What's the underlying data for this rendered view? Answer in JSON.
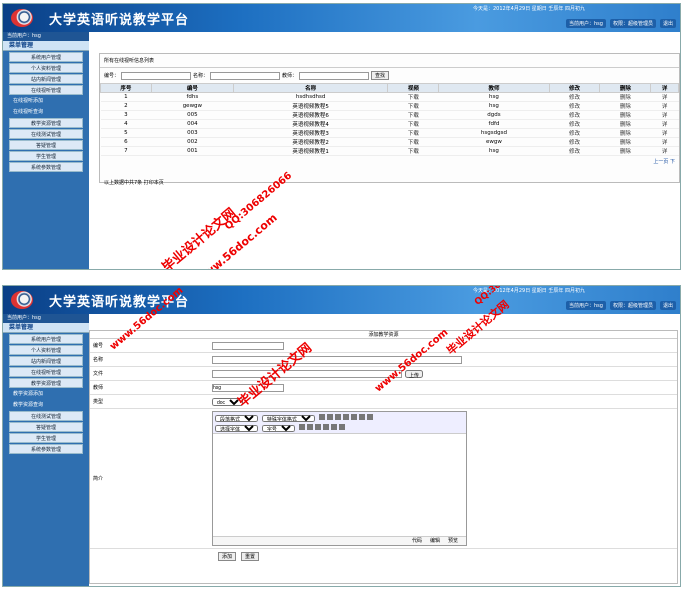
{
  "app_title": "大学英语听说教学平台",
  "date_line": "今天是：2012年4月29日 星期日 壬辰年 四月初九",
  "user_links": [
    "当前用户：hsg",
    "权限：超级管理员",
    "退出"
  ],
  "sidebar": {
    "top": "当前用户：hsg",
    "head": "菜单管理",
    "items1": [
      "系统用户管理",
      "个人资料管理",
      "站内新闻管理",
      "在线视听管理"
    ],
    "subs1": [
      "在线视听添加",
      "在线视听查询"
    ],
    "items1b": [
      "教学资源管理",
      "在线测试管理",
      "答疑管理",
      "学生管理",
      "系统参数管理"
    ],
    "items2": [
      "系统用户管理",
      "个人资料管理",
      "站内新闻管理",
      "在线视听管理",
      "教学资源管理"
    ],
    "subs2": [
      "教学资源添加",
      "教学资源查询"
    ],
    "items2b": [
      "在线测试管理",
      "答疑管理",
      "学生管理",
      "系统参数管理"
    ]
  },
  "list": {
    "title": "所有在线视听信息列表",
    "search": {
      "code_label": "编号：",
      "name_label": "名称：",
      "teacher_label": "教师：",
      "button": "查找"
    },
    "headers": [
      "序号",
      "编号",
      "名称",
      "视频",
      "教师",
      "修改",
      "删除",
      "详"
    ],
    "rows": [
      [
        "1",
        "fdhs",
        "hsdhsdhsd",
        "下载",
        "hsg",
        "修改",
        "删除",
        "详"
      ],
      [
        "2",
        "gewgw",
        "英语视频教程5",
        "下载",
        "hsg",
        "修改",
        "删除",
        "详"
      ],
      [
        "3",
        "005",
        "英语视频教程6",
        "下载",
        "dgds",
        "修改",
        "删除",
        "详"
      ],
      [
        "4",
        "004",
        "英语视频教程4",
        "下载",
        "fdfd",
        "修改",
        "删除",
        "详"
      ],
      [
        "5",
        "003",
        "英语视频教程3",
        "下载",
        "hsgsdgsd",
        "修改",
        "删除",
        "详"
      ],
      [
        "6",
        "002",
        "英语视频教程2",
        "下载",
        "ewgw",
        "修改",
        "删除",
        "详"
      ],
      [
        "7",
        "001",
        "英语视频教程1",
        "下载",
        "hsg",
        "修改",
        "删除",
        "详"
      ]
    ],
    "pager": "上一页 下",
    "footer": "以上数据中共7条 打印本页"
  },
  "form": {
    "title": "添加教学资源",
    "labels": {
      "code": "编号",
      "name": "名称",
      "file": "文件",
      "teacher": "教师",
      "type": "类型",
      "intro": "简介"
    },
    "teacher_value": "hsg",
    "type_value": "doc",
    "upload_button": "上传",
    "editor_selects": [
      "段落格式",
      "特殊字体格式",
      "选择字体",
      "字号"
    ],
    "editor_tabs": [
      "代码",
      "编辑",
      "预览"
    ],
    "submit": "添加",
    "reset": "重置"
  },
  "watermarks": {
    "site": "www.56doc.com",
    "qq": "QQ:306826066",
    "brand": "毕业设计论文网"
  }
}
